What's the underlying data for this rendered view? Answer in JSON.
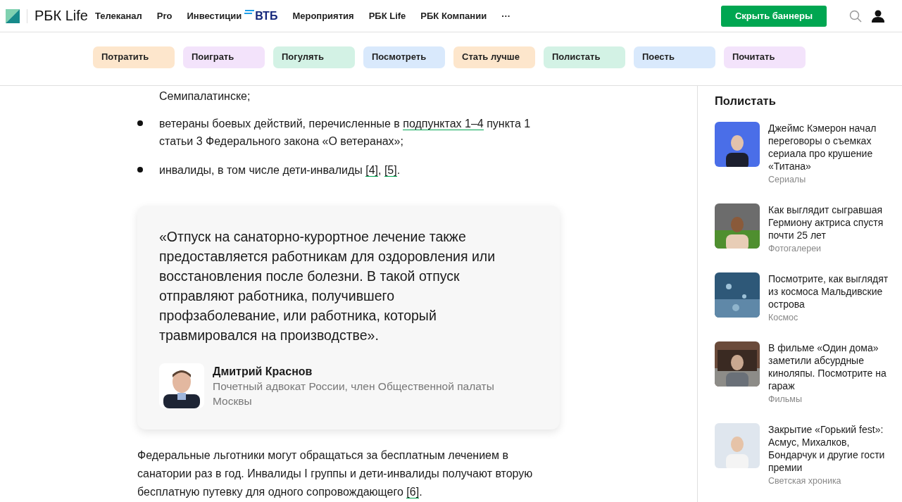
{
  "header": {
    "logo": "РБК Life",
    "nav": [
      {
        "label": "Телеканал"
      },
      {
        "label": "Pro"
      },
      {
        "label": "Инвестиции",
        "partner": "ВТБ"
      },
      {
        "label": "Мероприятия"
      },
      {
        "label": "РБК Life"
      },
      {
        "label": "РБК Компании"
      },
      {
        "label": "···"
      }
    ],
    "hide_banners_button": "Скрыть баннеры"
  },
  "categories": [
    {
      "label": "Потратить",
      "color": "#fde6cc"
    },
    {
      "label": "Поиграть",
      "color": "#f3e3fb"
    },
    {
      "label": "Погулять",
      "color": "#d3f2e5"
    },
    {
      "label": "Посмотреть",
      "color": "#d9e9fc"
    },
    {
      "label": "Стать лучше",
      "color": "#fde6cc"
    },
    {
      "label": "Полистать",
      "color": "#d3f2e5"
    },
    {
      "label": "Поесть",
      "color": "#d9e9fc"
    },
    {
      "label": "Почитать",
      "color": "#f3e3fb"
    }
  ],
  "article": {
    "list": [
      {
        "kind": "continuation",
        "segments": [
          {
            "text": "Семипалатинске;",
            "link": false
          }
        ]
      },
      {
        "kind": "bullet",
        "segments": [
          {
            "text": "ветераны боевых действий, перечисленные в ",
            "link": false
          },
          {
            "text": "подпунктах 1–4",
            "link": true
          },
          {
            "text": " пункта 1 статьи 3 Федерального закона «О ветеранах»;",
            "link": false
          }
        ]
      },
      {
        "kind": "bullet",
        "segments": [
          {
            "text": "инвалиды, в том числе дети-инвалиды ",
            "link": false
          },
          {
            "text": "[4]",
            "link": true
          },
          {
            "text": ", ",
            "link": false
          },
          {
            "text": "[5]",
            "link": true
          },
          {
            "text": ".",
            "link": false
          }
        ]
      }
    ],
    "quote": {
      "text": "«Отпуск на санаторно-курортное лечение также предоставляется работникам для оздоровления или восстановления после болезни. В такой отпуск отправляют работника, получившего профзаболевание, или работника, который травмировался на производстве».",
      "author": "Дмитрий Краснов",
      "role": "Почетный адвокат России, член Общественной палаты Москвы"
    },
    "paragraph": [
      {
        "text": "Федеральные льготники могут обращаться за бесплатным лечением в санатории раз в год. Инвалиды I группы и дети-инвалиды получают вторую бесплатную путевку для одного сопровождающего ",
        "link": false
      },
      {
        "text": "[6]",
        "link": true
      },
      {
        "text": ".",
        "link": false
      }
    ]
  },
  "sidebar": {
    "title": "Полистать",
    "items": [
      {
        "title": "Джеймс Кэмерон начал переговоры о съемках сериала про крушение «Титана»",
        "tag": "Сериалы"
      },
      {
        "title": "Как выглядит сыгравшая Гермиону актриса спустя почти 25 лет",
        "tag": "Фотогалереи"
      },
      {
        "title": "Посмотрите, как выглядят из космоса Мальдивские острова",
        "tag": "Космос"
      },
      {
        "title": "В фильме «Один дома» заметили абсурдные киноляпы. Посмотрите на гараж",
        "tag": "Фильмы"
      },
      {
        "title": "Закрытие «Горький fest»: Асмус, Михалков, Бондарчук и другие гости премии",
        "tag": "Светская хроника"
      }
    ]
  }
}
